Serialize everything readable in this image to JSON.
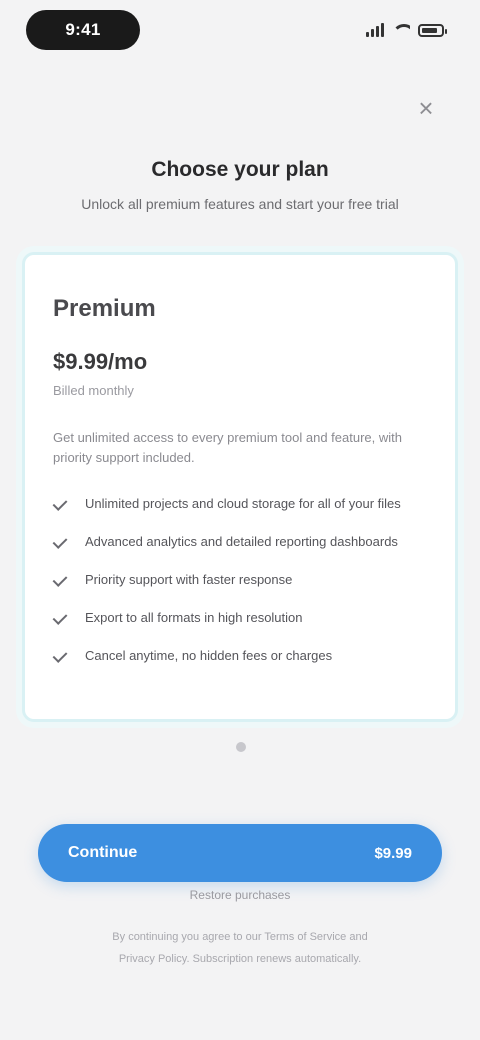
{
  "status_bar": {
    "time": "9:41"
  },
  "header": {
    "close": "×",
    "title": "Choose your plan",
    "subtitle": "Unlock all premium features and start your free trial"
  },
  "plan": {
    "name": "Premium",
    "price": "$9.99/mo",
    "billing": "Billed monthly",
    "description": "Get unlimited access to every premium tool and feature, with priority support included.",
    "features": [
      "Unlimited projects and cloud storage for all of your files",
      "Advanced analytics and detailed reporting dashboards",
      "Priority support with faster response",
      "Export to all formats in high resolution",
      "Cancel anytime, no hidden fees or charges"
    ]
  },
  "cta": {
    "label": "Continue",
    "price": "$9.99"
  },
  "restore": "Restore purchases",
  "legal": {
    "line1": "By continuing you agree to our Terms of Service and",
    "line2": "Privacy Policy. Subscription renews automatically."
  },
  "colors": {
    "accent": "#3d8fe0",
    "card_border": "#d9f1f4",
    "background": "#f3f3f4"
  },
  "icons": {
    "close": "close-icon",
    "feature": "checkmark-icon",
    "battery": "battery-icon",
    "wifi": "wifi-icon",
    "signal": "signal-icon"
  }
}
